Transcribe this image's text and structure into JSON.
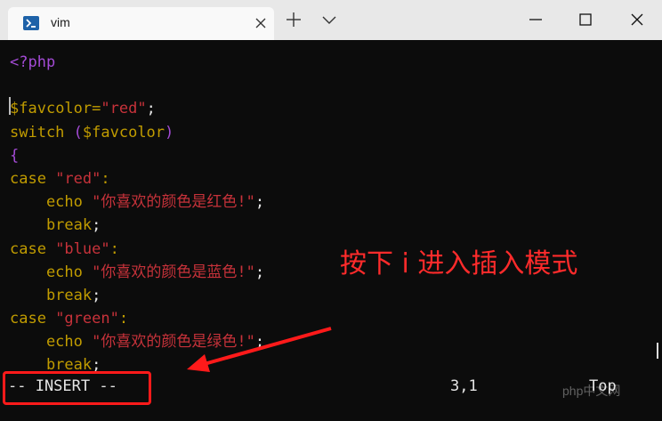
{
  "window": {
    "tab_title": "vim",
    "tab_icon": "terminal-icon"
  },
  "colors": {
    "keyword": "#c19c00",
    "php_tag": "#a44bd6",
    "string": "#c7323a",
    "annotation": "#ff2b2b",
    "background": "#0c0c0c"
  },
  "editor": {
    "lines": [
      [
        {
          "t": "<?php",
          "c": "purple"
        }
      ],
      [],
      [
        {
          "t": "$",
          "c": "kw"
        },
        {
          "t": "favcolor=",
          "c": "kw"
        },
        {
          "t": "\"red\"",
          "c": "red"
        },
        {
          "t": ";",
          "c": "white"
        }
      ],
      [
        {
          "t": "switch ",
          "c": "kw"
        },
        {
          "t": "(",
          "c": "purple"
        },
        {
          "t": "$favcolor",
          "c": "kw"
        },
        {
          "t": ")",
          "c": "purple"
        }
      ],
      [
        {
          "t": "{",
          "c": "purple"
        }
      ],
      [
        {
          "t": "case ",
          "c": "kw"
        },
        {
          "t": "\"red\"",
          "c": "red"
        },
        {
          "t": ":",
          "c": "kw"
        }
      ],
      [
        {
          "t": "    echo ",
          "c": "kw"
        },
        {
          "t": "\"你喜欢的颜色是红色!\"",
          "c": "red"
        },
        {
          "t": ";",
          "c": "white"
        }
      ],
      [
        {
          "t": "    break",
          "c": "kw"
        },
        {
          "t": ";",
          "c": "white"
        }
      ],
      [
        {
          "t": "case ",
          "c": "kw"
        },
        {
          "t": "\"blue\"",
          "c": "red"
        },
        {
          "t": ":",
          "c": "kw"
        }
      ],
      [
        {
          "t": "    echo ",
          "c": "kw"
        },
        {
          "t": "\"你喜欢的颜色是蓝色!\"",
          "c": "red"
        },
        {
          "t": ";",
          "c": "white"
        }
      ],
      [
        {
          "t": "    break",
          "c": "kw"
        },
        {
          "t": ";",
          "c": "white"
        }
      ],
      [
        {
          "t": "case ",
          "c": "kw"
        },
        {
          "t": "\"green\"",
          "c": "red"
        },
        {
          "t": ":",
          "c": "kw"
        }
      ],
      [
        {
          "t": "    echo ",
          "c": "kw"
        },
        {
          "t": "\"你喜欢的颜色是绿色!\"",
          "c": "red"
        },
        {
          "t": ";",
          "c": "white"
        }
      ],
      [
        {
          "t": "    break",
          "c": "kw"
        },
        {
          "t": ";",
          "c": "white"
        }
      ]
    ]
  },
  "status": {
    "mode": "-- INSERT --",
    "position": "3,1",
    "scroll": "Top"
  },
  "annotation": {
    "text": "按下 i 进入插入模式"
  },
  "watermark": "php中文网"
}
